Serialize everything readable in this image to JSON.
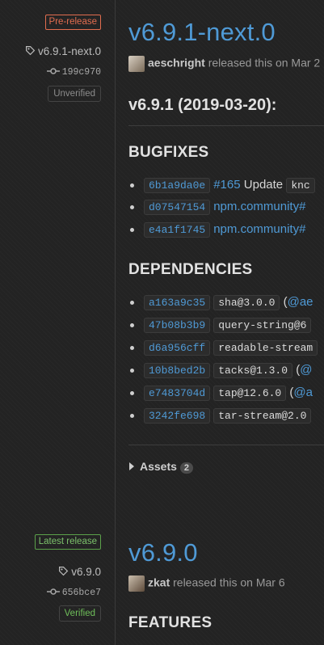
{
  "release1": {
    "badge": "Pre-release",
    "tag": "v6.9.1-next.0",
    "commit": "199c970",
    "verification": "Unverified",
    "title": "v6.9.1-next.0",
    "author": "aeschright",
    "released_text": "released this on Mar 2",
    "heading": "v6.9.1 (2019-03-20):",
    "bugfixes_title": "BUGFIXES",
    "bugfixes": [
      {
        "sha": "6b1a9da0e",
        "issue": "#165",
        "text": "Update",
        "code": "knc"
      },
      {
        "sha": "d07547154",
        "link": "npm.community#"
      },
      {
        "sha": "e4a1f1745",
        "link": "npm.community#"
      }
    ],
    "deps_title": "DEPENDENCIES",
    "deps": [
      {
        "sha": "a163a9c35",
        "pkg": "sha@3.0.0",
        "tail": "(",
        "tail_link": "@ae"
      },
      {
        "sha": "47b08b3b9",
        "pkg": "query-string@6"
      },
      {
        "sha": "d6a956cff",
        "pkg": "readable-stream"
      },
      {
        "sha": "10b8bed2b",
        "pkg": "tacks@1.3.0",
        "tail": "(",
        "tail_link": "@"
      },
      {
        "sha": "e7483704d",
        "pkg": "tap@12.6.0",
        "tail": "(",
        "tail_link": "@a"
      },
      {
        "sha": "3242fe698",
        "pkg": "tar-stream@2.0"
      }
    ],
    "assets_label": "Assets",
    "assets_count": "2"
  },
  "release2": {
    "badge": "Latest release",
    "tag": "v6.9.0",
    "commit": "656bce7",
    "verification": "Verified",
    "title": "v6.9.0",
    "author": "zkat",
    "released_text": "released this on Mar 6",
    "features_title": "FEATURES"
  },
  "colors": {
    "background": "#232323",
    "link": "#4f9ad6",
    "prerelease": "#e26d4f",
    "latest": "#7cc26b"
  }
}
